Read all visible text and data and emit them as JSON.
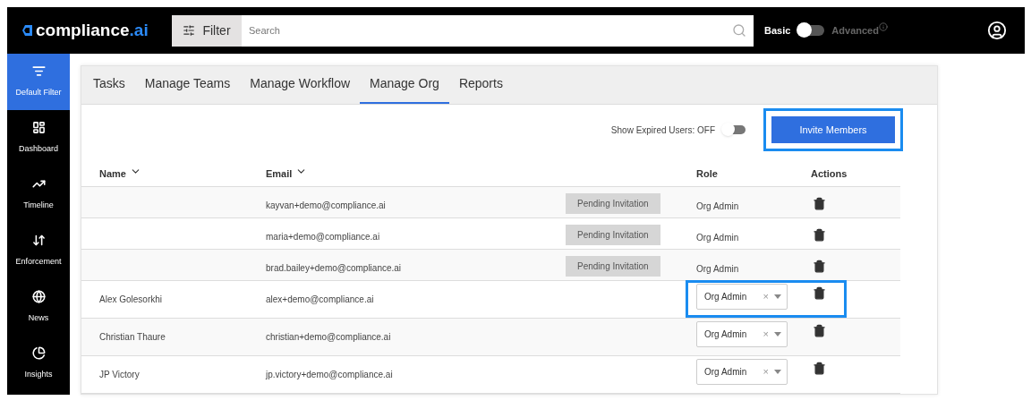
{
  "header": {
    "logo_main": "compliance",
    "logo_accent": ".ai",
    "filter_button": "Filter",
    "search": {
      "placeholder": "Search"
    },
    "mode_basic": "Basic",
    "mode_advanced": "Advanced",
    "advanced_on": false
  },
  "sidebar": {
    "items": [
      {
        "label": "Default Filter",
        "selected": true
      },
      {
        "label": "Dashboard",
        "selected": false
      },
      {
        "label": "Timeline",
        "selected": false
      },
      {
        "label": "Enforcement",
        "selected": false
      },
      {
        "label": "News",
        "selected": false
      },
      {
        "label": "Insights",
        "selected": false
      }
    ]
  },
  "tabs": [
    {
      "label": "Tasks",
      "selected": false
    },
    {
      "label": "Manage Teams",
      "selected": false
    },
    {
      "label": "Manage Workflow",
      "selected": false
    },
    {
      "label": "Manage Org",
      "selected": true
    },
    {
      "label": "Reports",
      "selected": false
    }
  ],
  "toolbar": {
    "expired_label": "Show Expired Users: OFF",
    "show_expired": false,
    "invite_button": "Invite Members",
    "invite_highlighted": true
  },
  "table": {
    "columns": [
      "Name",
      "Email",
      "Role",
      "Actions"
    ],
    "rows": [
      {
        "name": "",
        "email": "kayvan+demo@compliance.ai",
        "status": "Pending Invitation",
        "role": "Org Admin",
        "kind": "text"
      },
      {
        "name": "",
        "email": "maria+demo@compliance.ai",
        "status": "Pending Invitation",
        "role": "Org Admin",
        "kind": "text"
      },
      {
        "name": "",
        "email": "brad.bailey+demo@compliance.ai",
        "status": "Pending Invitation",
        "role": "Org Admin",
        "kind": "text"
      },
      {
        "name": "Alex Golesorkhi",
        "email": "alex+demo@compliance.ai",
        "role": "Org Admin",
        "kind": "select",
        "clear": "×",
        "highlighted": true
      },
      {
        "name": "Christian Thaure",
        "email": "christian+demo@compliance.ai",
        "role": "Org Admin",
        "kind": "select",
        "clear": "×",
        "highlighted": false
      },
      {
        "name": "JP Victory",
        "email": "jp.victory+demo@compliance.ai",
        "role": "Org Admin",
        "kind": "select",
        "clear": "×",
        "highlighted": false
      }
    ]
  }
}
